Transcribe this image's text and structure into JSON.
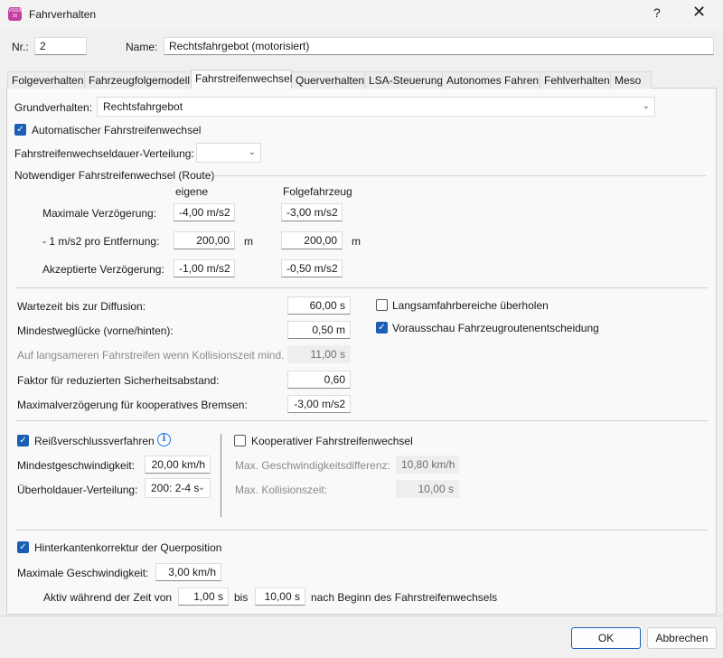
{
  "window": {
    "title": "Fahrverhalten",
    "app_icon_text": "VISSIM 26",
    "help": "?",
    "close": "✕"
  },
  "header": {
    "nr_label": "Nr.:",
    "nr_value": "2",
    "name_label": "Name:",
    "name_value": "Rechtsfahrgebot (motorisiert)"
  },
  "tabs": [
    "Folgeverhalten",
    "Fahrzeugfolgemodell",
    "Fahrstreifenwechsel",
    "Querverhalten",
    "LSA-Steuerung",
    "Autonomes Fahren",
    "Fehlverhalten",
    "Meso"
  ],
  "active_tab": "Fahrstreifenwechsel",
  "general": {
    "grund_label": "Grundverhalten:",
    "grund_value": "Rechtsfahrgebot",
    "auto_label": "Automatischer Fahrstreifenwechsel",
    "dauer_label": "Fahrstreifenwechseldauer-Verteilung:",
    "dauer_value": ""
  },
  "route": {
    "group_label": "Notwendiger Fahrstreifenwechsel (Route)",
    "col_own": "eigene",
    "col_follow": "Folgefahrzeug",
    "max_label": "Maximale Verzögerung:",
    "max_own": "-4,00 m/s2",
    "max_follow": "-3,00 m/s2",
    "dist_label": "- 1 m/s2 pro Entfernung:",
    "dist_own": "200,00",
    "dist_follow": "200,00",
    "unit_m": "m",
    "acc_label": "Akzeptierte Verzögerung:",
    "acc_own": "-1,00 m/s2",
    "acc_follow": "-0,50 m/s2"
  },
  "params": {
    "wait_label": "Wartezeit bis zur Diffusion:",
    "wait_value": "60,00 s",
    "gap_label": "Mindestweglücke (vorne/hinten):",
    "gap_value": "0,50 m",
    "slow_label": "Auf langsameren Fahrstreifen wenn Kollisionszeit mind.",
    "slow_value": "11,00 s",
    "factor_label": "Faktor für reduzierten Sicherheitsabstand:",
    "factor_value": "0,60",
    "coop_brake_label": "Maximalverzögerung für kooperatives Bremsen:",
    "coop_brake_value": "-3,00 m/s2",
    "overtake_label": "Langsamfahrbereiche überholen",
    "preview_label": "Vorausschau Fahrzeugroutenentscheidung"
  },
  "zipper": {
    "label": "Reißverschlussverfahren",
    "info_icon": "i",
    "minspeed_label": "Mindestgeschwindigkeit:",
    "minspeed_value": "20,00 km/h",
    "hold_label": "Überholdauer-Verteilung:",
    "hold_value": "200: 2-4 s"
  },
  "coop": {
    "label": "Kooperativer Fahrstreifenwechsel",
    "speed_diff_label": "Max. Geschwindigkeitsdifferenz:",
    "speed_diff_value": "10,80 km/h",
    "coll_label": "Max. Kollisionszeit:",
    "coll_value": "10,00 s"
  },
  "rear": {
    "label": "Hinterkantenkorrektur der Querposition",
    "maxspeed_label": "Maximale Geschwindigkeit:",
    "maxspeed_value": "3,00 km/h",
    "active_label": "Aktiv während der Zeit von",
    "from_value": "1,00 s",
    "bis": "bis",
    "to_value": "10,00 s",
    "after": "nach Beginn des Fahrstreifenwechsels"
  },
  "footer": {
    "ok": "OK",
    "cancel": "Abbrechen"
  }
}
